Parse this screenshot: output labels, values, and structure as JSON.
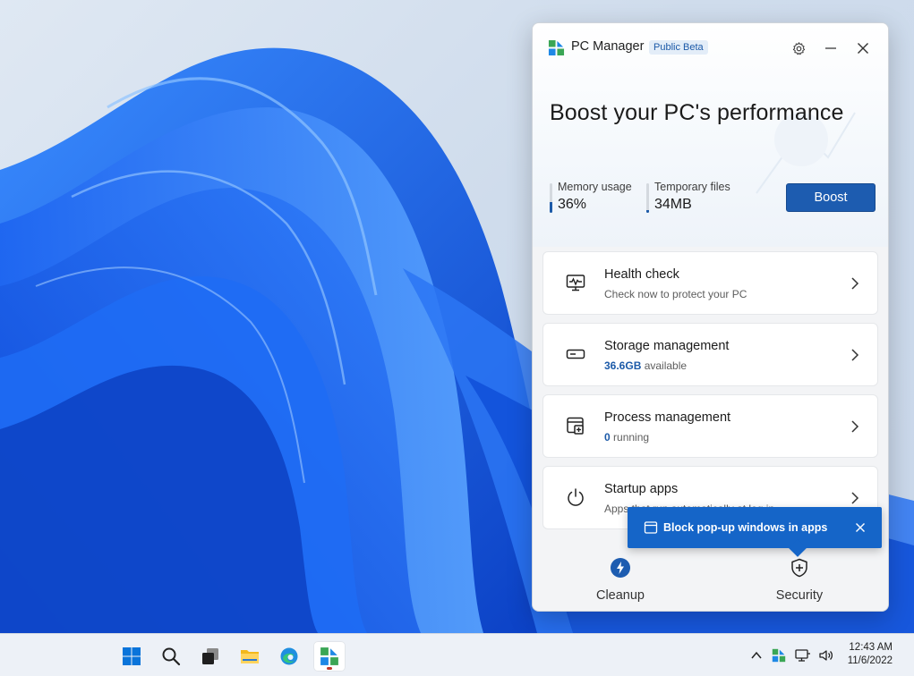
{
  "app": {
    "title": "PC Manager",
    "badge": "Public Beta",
    "headline": "Boost your PC's performance",
    "settings_icon": "gear-icon",
    "minimize_icon": "minimize-icon",
    "close_icon": "close-icon"
  },
  "metrics": [
    {
      "label": "Memory usage",
      "value": "36%",
      "level": 0.36
    },
    {
      "label": "Temporary files",
      "value": "34MB",
      "level": 0.1
    }
  ],
  "boost_label": "Boost",
  "cards": [
    {
      "title": "Health check",
      "sub_strong": "",
      "sub_text": "Check now to protect your PC",
      "icon": "monitor-pulse-icon"
    },
    {
      "title": "Storage management",
      "sub_strong": "36.6GB",
      "sub_text": " available",
      "icon": "drive-icon"
    },
    {
      "title": "Process management",
      "sub_strong": "0",
      "sub_text": " running",
      "icon": "process-window-icon"
    },
    {
      "title": "Startup apps",
      "sub_strong": "",
      "sub_text": "Apps that run automatically at log in",
      "icon": "power-icon"
    }
  ],
  "nav": {
    "cleanup": "Cleanup",
    "security": "Security"
  },
  "toast": {
    "text": "Block pop-up windows in apps"
  },
  "taskbar": {
    "time": "12:43 AM",
    "date": "11/6/2022",
    "colors": {
      "accent": "#1d5cb0",
      "toast": "#1565c8"
    }
  }
}
